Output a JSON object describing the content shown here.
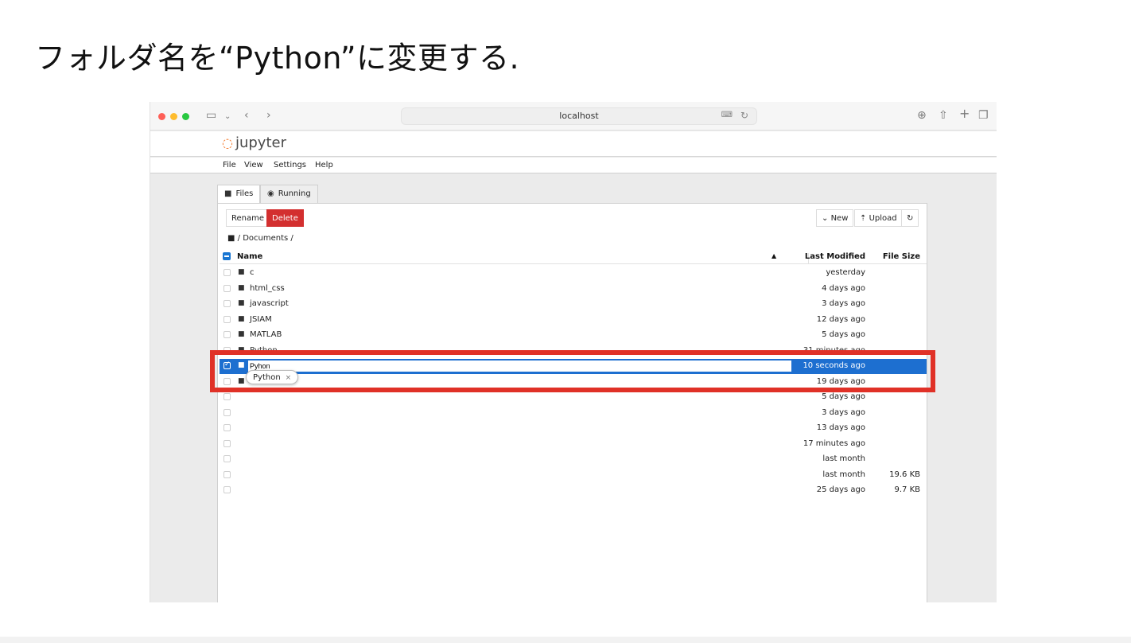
{
  "slide": {
    "title": "フォルダ名を“Python”に変更する."
  },
  "browser": {
    "url": "localhost",
    "translate_icon": "translate-icon",
    "traffic_colors": [
      "#fe5f57",
      "#febc2e",
      "#28c840"
    ]
  },
  "jupyter": {
    "logo_text": "jupyter",
    "menu": [
      "File",
      "View",
      "Settings",
      "Help"
    ],
    "tabs": [
      {
        "label": "Files",
        "icon": "folder-icon"
      },
      {
        "label": "Running",
        "icon": "running-icon"
      }
    ],
    "toolbar": {
      "rename": "Rename",
      "delete": "Delete",
      "new": "New",
      "upload": "Upload",
      "refresh": "↻"
    },
    "breadcrumb": "/ Documents /",
    "columns": {
      "name": "Name",
      "modified": "Last Modified",
      "size": "File Size"
    },
    "rows": [
      {
        "name": "c",
        "modified": "yesterday",
        "size": ""
      },
      {
        "name": "html_css",
        "modified": "4 days ago",
        "size": ""
      },
      {
        "name": "javascript",
        "modified": "3 days ago",
        "size": ""
      },
      {
        "name": "JSIAM",
        "modified": "12 days ago",
        "size": ""
      },
      {
        "name": "MATLAB",
        "modified": "5 days ago",
        "size": ""
      },
      {
        "name": "Python",
        "modified": "31 minutes ago",
        "size": ""
      },
      {
        "name": "",
        "modified": "10 seconds ago",
        "size": "",
        "editing": true,
        "edit_value": "Pyhon"
      },
      {
        "name": "",
        "modified": "19 days ago",
        "size": ""
      },
      {
        "name": "",
        "modified": "5 days ago",
        "size": ""
      },
      {
        "name": "",
        "modified": "3 days ago",
        "size": ""
      },
      {
        "name": "",
        "modified": "13 days ago",
        "size": ""
      },
      {
        "name": "",
        "modified": "17 minutes ago",
        "size": ""
      },
      {
        "name": "",
        "modified": "last month",
        "size": ""
      },
      {
        "name": "",
        "modified": "last month",
        "size": "19.6 KB"
      },
      {
        "name": "",
        "modified": "25 days ago",
        "size": "9.7 KB"
      }
    ],
    "autocomplete": {
      "suggestion": "Python",
      "close": "×"
    }
  },
  "annotation": {
    "color": "#e03127"
  }
}
